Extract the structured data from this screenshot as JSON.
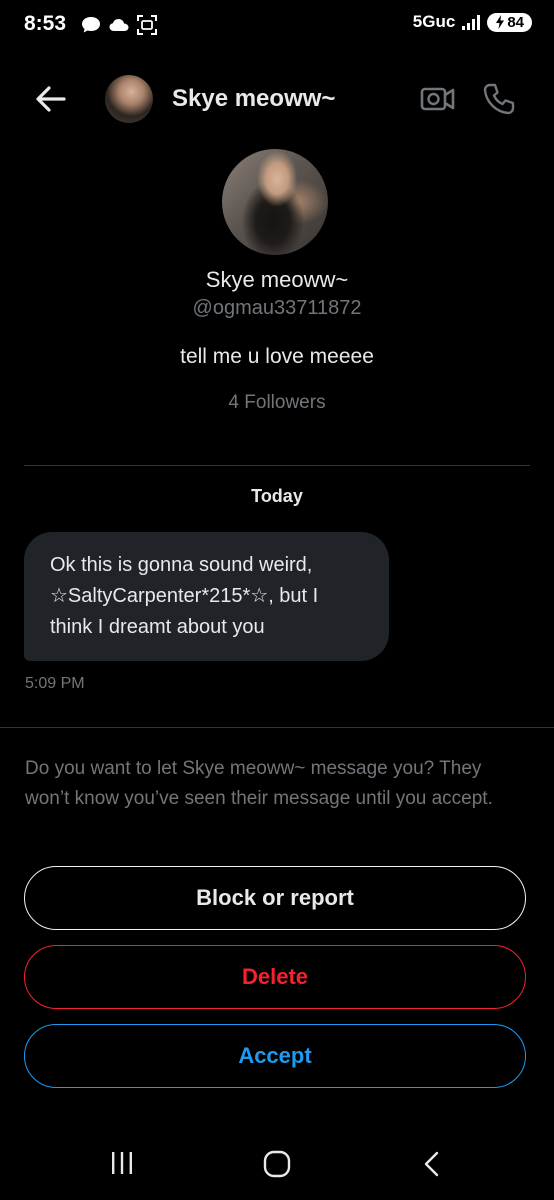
{
  "status_bar": {
    "time": "8:53",
    "network": "5Guc",
    "battery": "84"
  },
  "header": {
    "name": "Skye meoww~"
  },
  "profile": {
    "name": "Skye meoww~",
    "handle": "@ogmau33711872",
    "bio": "tell me u love meeee",
    "followers": "4 Followers"
  },
  "conversation": {
    "date_label": "Today",
    "messages": [
      {
        "text": "Ok this is gonna sound weird, ☆SaltyCarpenter*215*☆, but I think I dreamt about you",
        "time": "5:09 PM"
      }
    ]
  },
  "request": {
    "prompt": "Do you want to let Skye meoww~ message you? They won’t know you’ve seen their message until you accept.",
    "block_label": "Block or report",
    "delete_label": "Delete",
    "accept_label": "Accept"
  },
  "icons": {
    "back": "arrow-left-icon",
    "video": "video-camera-icon",
    "call": "phone-icon",
    "nav_recents": "recents-icon",
    "nav_home": "home-icon",
    "nav_back": "nav-back-icon"
  },
  "colors": {
    "background": "#000000",
    "bubble": "#202327",
    "secondary_text": "#71767b",
    "delete": "#f4212e",
    "accept": "#1d9bf0",
    "header_icons": "#71767b"
  }
}
